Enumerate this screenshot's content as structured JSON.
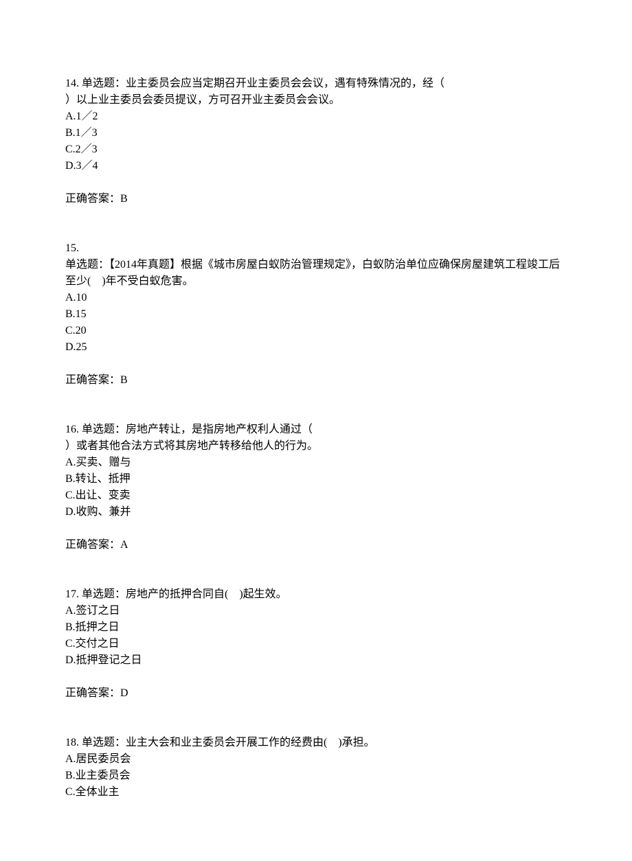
{
  "questions": [
    {
      "num": "14.",
      "type_line1": " 单选题：业主委员会应当定期召开业主委员会会议，遇有特殊情况的，经（",
      "type_line2": " ）以上业主委员会委员提议，方可召开业主委员会会议。",
      "opts": [
        "A.1／2",
        "B.1／3",
        "C.2／3",
        "D.3／4"
      ],
      "answer": "正确答案：B"
    },
    {
      "num": "15.",
      "type_line1": "单选题：【2014年真题】根据《城市房屋白蚁防治管理规定》，白蚁防治单位应确保房屋建筑工程竣工后至少(　)年不受白蚁危害。",
      "opts": [
        "A.10",
        "B.15",
        "C.20",
        "D.25"
      ],
      "answer": "正确答案：B"
    },
    {
      "num": "16.",
      "type_line1": " 单选题：房地产转让，是指房地产权利人通过（",
      "type_line2": " ）或者其他合法方式将其房地产转移给他人的行为。",
      "opts": [
        "A.买卖、赠与",
        "B.转让、抵押",
        "C.出让、变卖",
        "D.收购、兼并"
      ],
      "answer": "正确答案：A"
    },
    {
      "num": "17.",
      "type_line1": " 单选题：房地产的抵押合同自(　)起生效。",
      "opts": [
        "A.签订之日",
        "B.抵押之日",
        "C.交付之日",
        "D.抵押登记之日"
      ],
      "answer": "正确答案：D"
    },
    {
      "num": "18.",
      "type_line1": " 单选题：业主大会和业主委员会开展工作的经费由(　)承担。",
      "opts": [
        "A.居民委员会",
        "B.业主委员会",
        "C.全体业主"
      ],
      "answer": ""
    }
  ]
}
